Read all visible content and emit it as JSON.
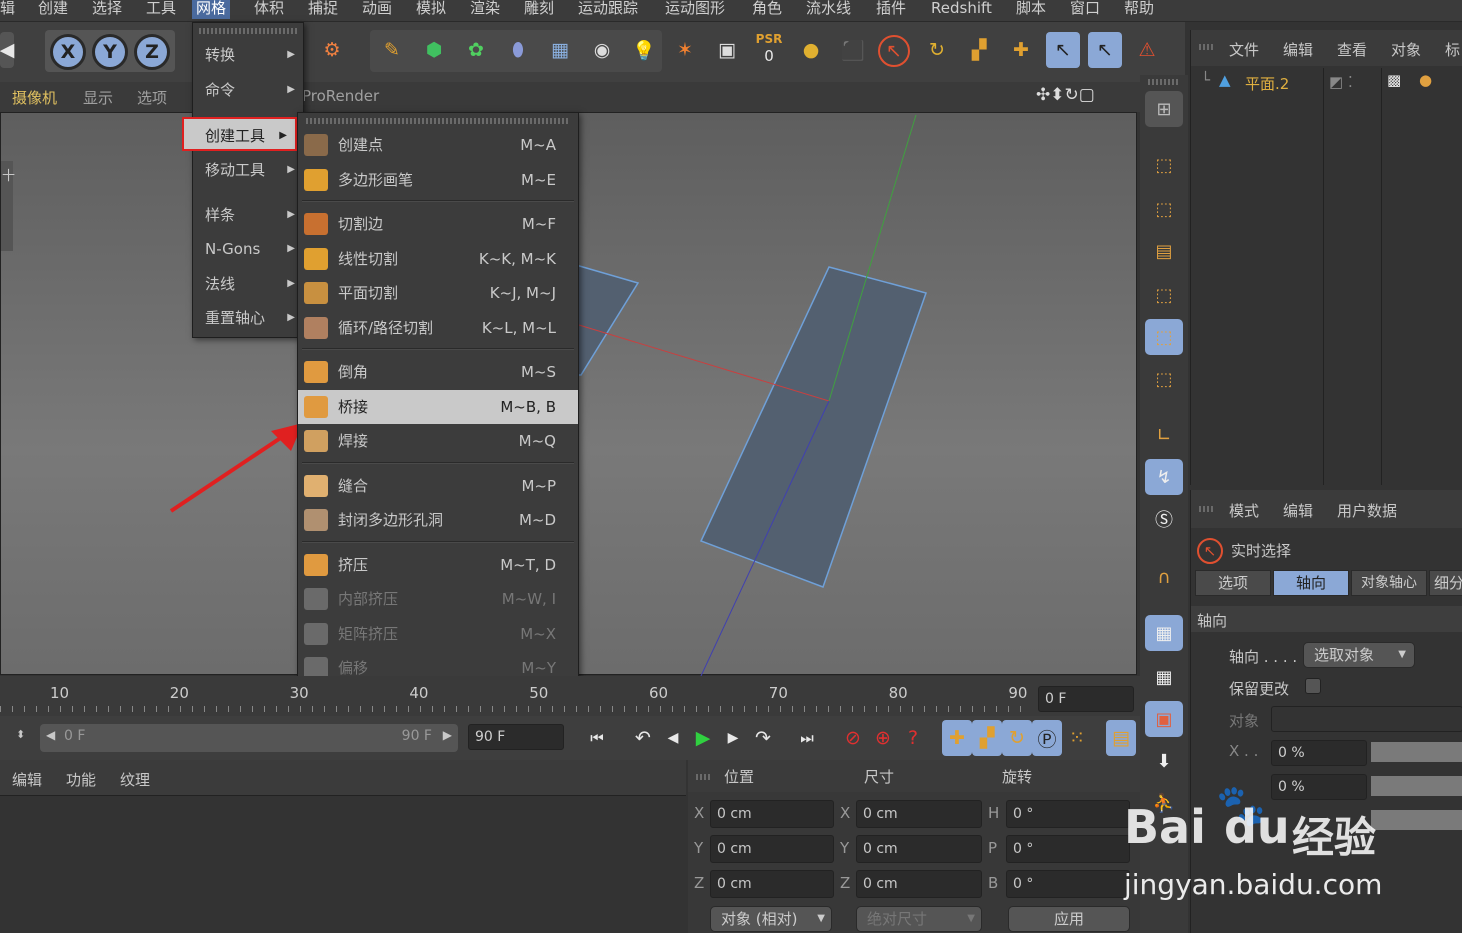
{
  "menubar": {
    "items": [
      "辑",
      "创建",
      "选择",
      "工具",
      "网格",
      "体积",
      "捕捉",
      "动画",
      "模拟",
      "渲染",
      "雕刻",
      "运动跟踪",
      "运动图形",
      "角色",
      "流水线",
      "插件",
      "Redshift",
      "脚本",
      "窗口",
      "帮助"
    ],
    "active": "网格"
  },
  "toolbar": {
    "axes": [
      "X",
      "Y",
      "Z"
    ],
    "psr_label": "PSR",
    "psr_value": "0"
  },
  "viewport": {
    "menus": [
      "摄像机",
      "显示",
      "选项"
    ],
    "renderer": "ProRender",
    "left_marker": "十"
  },
  "mesh_menu": {
    "items": [
      {
        "label": "转换"
      },
      {
        "label": "命令"
      },
      {
        "label": "创建工具"
      },
      {
        "label": "移动工具"
      },
      {
        "label": "样条"
      },
      {
        "label": "N-Gons"
      },
      {
        "label": "法线"
      },
      {
        "label": "重置轴心"
      }
    ],
    "highlighted": "创建工具"
  },
  "create_tools_menu": {
    "items": [
      {
        "label": "创建点",
        "shortcut": "M~A",
        "icon": "create-point-icon",
        "color": "#8a6a4a",
        "enabled": true
      },
      {
        "label": "多边形画笔",
        "shortcut": "M~E",
        "icon": "polygon-pen-icon",
        "color": "#e0a030",
        "enabled": true
      },
      {
        "label": "切割边",
        "shortcut": "M~F",
        "icon": "edge-cut-icon",
        "color": "#c87030",
        "enabled": true
      },
      {
        "label": "线性切割",
        "shortcut": "K~K, M~K",
        "icon": "knife-icon",
        "color": "#e0a030",
        "enabled": true
      },
      {
        "label": "平面切割",
        "shortcut": "K~J, M~J",
        "icon": "plane-cut-icon",
        "color": "#c89040",
        "enabled": true
      },
      {
        "label": "循环/路径切割",
        "shortcut": "K~L, M~L",
        "icon": "loop-cut-icon",
        "color": "#b08060",
        "enabled": true
      },
      {
        "label": "倒角",
        "shortcut": "M~S",
        "icon": "bevel-icon",
        "color": "#e09a40",
        "enabled": true
      },
      {
        "label": "桥接",
        "shortcut": "M~B, B",
        "icon": "bridge-icon",
        "color": "#e09a40",
        "enabled": true
      },
      {
        "label": "焊接",
        "shortcut": "M~Q",
        "icon": "weld-icon",
        "color": "#d0a060",
        "enabled": true
      },
      {
        "label": "缝合",
        "shortcut": "M~P",
        "icon": "stitch-icon",
        "color": "#e0b070",
        "enabled": true
      },
      {
        "label": "封闭多边形孔洞",
        "shortcut": "M~D",
        "icon": "close-hole-icon",
        "color": "#b09070",
        "enabled": true
      },
      {
        "label": "挤压",
        "shortcut": "M~T, D",
        "icon": "extrude-icon",
        "color": "#e09a40",
        "enabled": true
      },
      {
        "label": "内部挤压",
        "shortcut": "M~W, I",
        "icon": "inner-extrude-icon",
        "color": "#6a6a6a",
        "enabled": false
      },
      {
        "label": "矩阵挤压",
        "shortcut": "M~X",
        "icon": "matrix-extrude-icon",
        "color": "#6a6a6a",
        "enabled": false
      },
      {
        "label": "偏移",
        "shortcut": "M~Y",
        "icon": "offset-icon",
        "color": "#6a6a6a",
        "enabled": false
      }
    ],
    "highlighted": "桥接"
  },
  "object_manager": {
    "menus": [
      "文件",
      "编辑",
      "查看",
      "对象",
      "标"
    ],
    "objects": [
      {
        "name": "平面.2"
      }
    ]
  },
  "attributes": {
    "menus": [
      "模式",
      "编辑",
      "用户数据"
    ],
    "tool_name": "实时选择",
    "tabs": [
      "选项",
      "轴向",
      "对象轴心",
      "细分"
    ],
    "active_tab": "轴向",
    "section": "轴向",
    "axis_label": "轴向 . . . .",
    "axis_value": "选取对象",
    "keep_changes_label": "保留更改",
    "object_label": "对象",
    "x_label": "X . .",
    "x_value": "0 %",
    "y_value": "0 %"
  },
  "timeline": {
    "ticks": [
      "10",
      "20",
      "30",
      "40",
      "50",
      "60",
      "70",
      "80",
      "90"
    ],
    "frame_field": "0 F"
  },
  "transport": {
    "start": "0 F",
    "end": "90 F",
    "end_field": "90 F"
  },
  "material_manager": {
    "menus": [
      "编辑",
      "功能",
      "纹理"
    ]
  },
  "coordinates": {
    "headers": [
      "位置",
      "尺寸",
      "旋转"
    ],
    "rows": [
      {
        "pos_axis": "X",
        "pos": "0 cm",
        "size_axis": "X",
        "size": "0 cm",
        "rot_axis": "H",
        "rot": "0 °"
      },
      {
        "pos_axis": "Y",
        "pos": "0 cm",
        "size_axis": "Y",
        "size": "0 cm",
        "rot_axis": "P",
        "rot": "0 °"
      },
      {
        "pos_axis": "Z",
        "pos": "0 cm",
        "size_axis": "Z",
        "size": "0 cm",
        "rot_axis": "B",
        "rot": "0 °"
      }
    ],
    "mode_select": "对象 (相对)",
    "size_select": "绝对尺寸",
    "apply": "应用"
  },
  "watermark": {
    "brand": "Bai",
    "brand2": "du",
    "cn": "经验",
    "url": "jingyan.baidu.com"
  }
}
